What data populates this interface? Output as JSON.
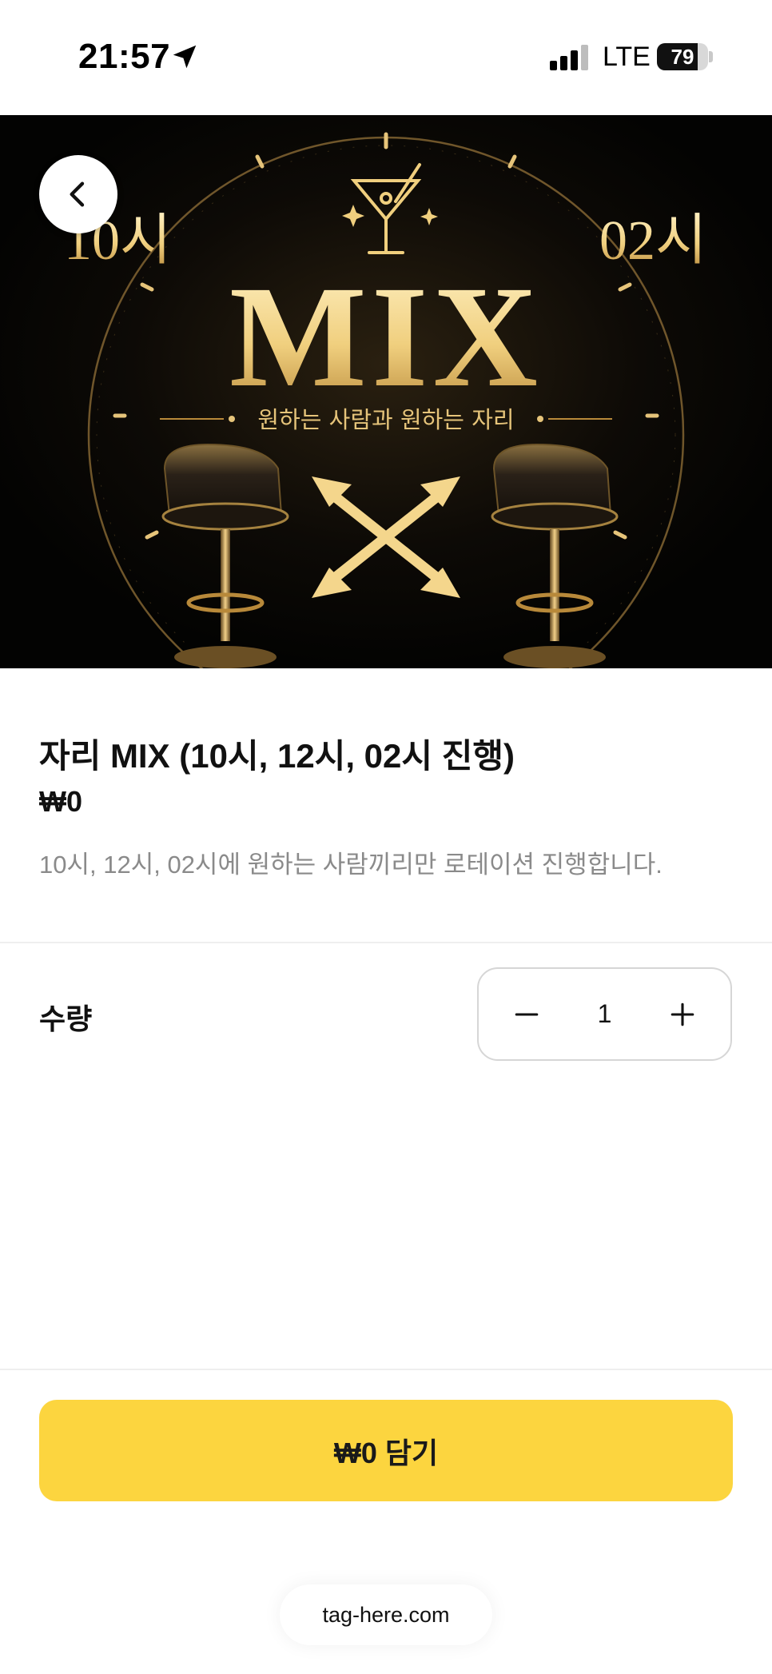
{
  "status_bar": {
    "time": "21:57",
    "network": "LTE",
    "battery": "79",
    "battery_level": 0.79,
    "icons": [
      "location-arrow-icon",
      "signal-bars-icon",
      "battery-icon"
    ]
  },
  "hero": {
    "left_time": "10시",
    "right_time": "02시",
    "title": "MIX",
    "subtitle": "원하는 사람과 원하는 자리",
    "colors": {
      "background": "#050403",
      "gold": "#e8c77a"
    }
  },
  "nav": {
    "back_icon": "chevron-left-icon"
  },
  "product": {
    "name": "자리 MIX (10시, 12시, 02시 진행)",
    "price": "₩0",
    "description": "10시, 12시, 02시에 원하는 사람끼리만 로테이션 진행합니다."
  },
  "quantity": {
    "label": "수량",
    "value": "1",
    "minus_icon": "minus-icon",
    "plus_icon": "plus-icon"
  },
  "cta": {
    "label": "₩0 담기",
    "color": "#fcd53f"
  },
  "footer": {
    "domain": "tag-here.com"
  }
}
